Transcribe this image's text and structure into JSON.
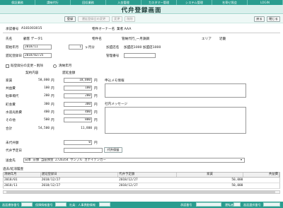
{
  "nav": [
    "保証業務",
    "請納代行",
    "回収業務",
    "入金管理",
    "カスタマー管理",
    "システム管理",
    "名寄せ照会",
    "LOGIN"
  ],
  "title": "代弁登録画面",
  "toolbar": {
    "register": "登録",
    "change_reg_date": "運延登録日の変更",
    "change": "変更",
    "delete": "削除",
    "back": "戻る",
    "close": "閉じる"
  },
  "contract": {
    "label": "承認番号",
    "value": "A181003015",
    "owner_label": "物件オーナー名",
    "owner_value": "業者  AAA"
  },
  "customer": {
    "name_label": "氏名",
    "name_value": "顧客  データ1",
    "property_label": "物件名",
    "property_value": "管納代行_一月鉄鋼",
    "area_label": "エリア",
    "area_value": "近畿"
  },
  "start": {
    "label": "開始年月",
    "value": "2018/11",
    "months": "1",
    "months_unit": "ヶ月分",
    "store_label": "加盟店名",
    "store_value": "加盟店1000  加盟店1000"
  },
  "delay_date": {
    "label": "遅延登録日",
    "value": "2018/02/25",
    "manager_label": "管理番号"
  },
  "options": {
    "change_label": "既登録分の変更・削除",
    "month_label": "清納年月"
  },
  "amounts": {
    "col1_label": "契約内容",
    "col2_label": "遅延金額",
    "yen": "円",
    "rows": [
      {
        "label": "家賃",
        "contract": "50,000",
        "delay": "10,000"
      },
      {
        "label": "共益費",
        "contract": "100",
        "delay": "100"
      },
      {
        "label": "駐車場代",
        "contract": "200",
        "delay": "200"
      },
      {
        "label": "町会費",
        "contract": "300",
        "delay": "300"
      },
      {
        "label": "水道光熱費",
        "contract": "400",
        "delay": "400"
      },
      {
        "label": "その他",
        "contract": "500",
        "delay": "800"
      },
      {
        "label": "合計",
        "contract": "54,500",
        "delay": "11,800"
      }
    ]
  },
  "memo": {
    "request_label": "申込メモ情報",
    "company_label": "社内メッセージ"
  },
  "uncollected": {
    "label": "未代弁額",
    "value": "0",
    "unit": "円"
  },
  "schedule": {
    "label": "代弁予定日",
    "button": "代弁保留"
  },
  "transfer": {
    "label": "送金先",
    "value": "日本  宗像  当座預金  2726354  サンプル  カナイテンガー"
  },
  "history": {
    "title": "過去/延滞履歴",
    "headers": [
      "清納年月",
      "遅延登録日",
      "代弁予定額",
      "家賃",
      "共益費"
    ],
    "rows": [
      [
        "2018/01",
        "2018/12/27",
        "2018/12/27",
        "50,000",
        ""
      ],
      [
        "2018/11",
        "2018/12/27",
        "2018/12/27",
        "50,000",
        ""
      ]
    ]
  },
  "status": {
    "item1": "画面遷移番号",
    "item2": "保障情報番号",
    "item3": "社員：人事異動情報",
    "item4": "承認番号",
    "item5": "運転者",
    "item6": "画面選択番号"
  }
}
